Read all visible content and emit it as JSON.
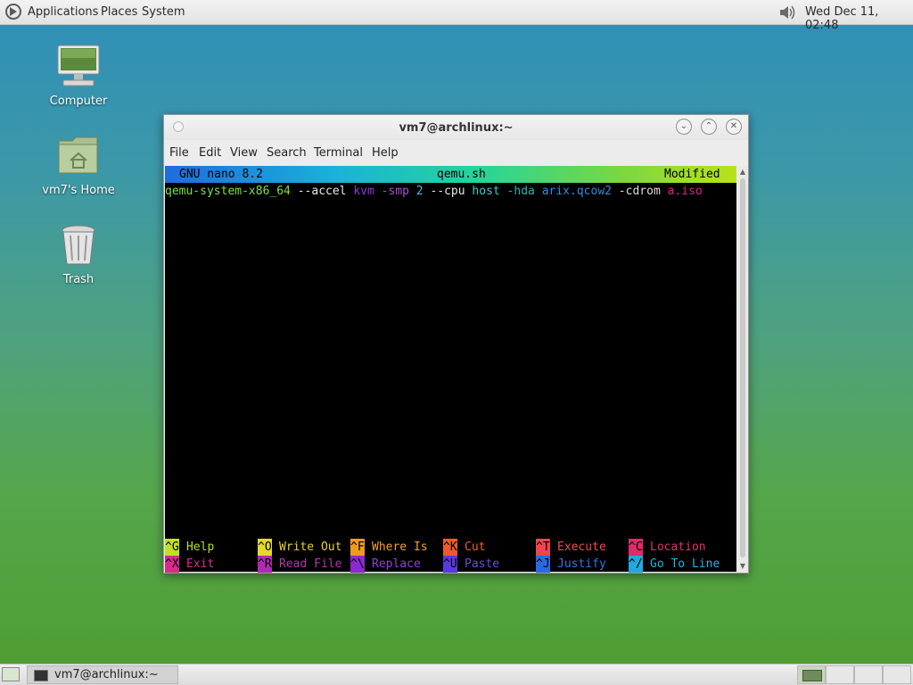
{
  "top_panel": {
    "menus": [
      "Applications",
      "Places",
      "System"
    ],
    "clock": "Wed Dec 11, 02:48"
  },
  "desktop_icons": [
    {
      "label": "Computer",
      "icon": "computer-icon"
    },
    {
      "label": "vm7's Home",
      "icon": "home-folder-icon"
    },
    {
      "label": "Trash",
      "icon": "trash-icon"
    }
  ],
  "window": {
    "title": "vm7@archlinux:~",
    "menubar": [
      "File",
      "Edit",
      "View",
      "Search",
      "Terminal",
      "Help"
    ],
    "nano": {
      "version": "GNU nano 8.2",
      "filename": "qemu.sh",
      "status": "Modified",
      "content_tokens": [
        {
          "text": "qemu-system-x86_64",
          "color": "#7be03a"
        },
        {
          "text": " --accel ",
          "color": "#e8e8e8"
        },
        {
          "text": "kvm",
          "color": "#8a3ad8"
        },
        {
          "text": " -smp ",
          "color": "#a64dd6"
        },
        {
          "text": "2",
          "color": "#3cc0d8"
        },
        {
          "text": " --cpu ",
          "color": "#e8e8e8"
        },
        {
          "text": "host",
          "color": "#3cc8d4"
        },
        {
          "text": " -hda ",
          "color": "#26b2a8"
        },
        {
          "text": "arix.qcow2",
          "color": "#2d8ce0"
        },
        {
          "text": " -cdrom ",
          "color": "#dddddd"
        },
        {
          "text": "a.iso",
          "color": "#e0208a"
        }
      ],
      "shortcuts": [
        {
          "key": "^G",
          "label": "Help",
          "key_bg": "#c2e020",
          "label_color": "#b6e026"
        },
        {
          "key": "^O",
          "label": "Write Out",
          "key_bg": "#e6d82a",
          "label_color": "#e6d22a"
        },
        {
          "key": "^F",
          "label": "Where Is",
          "key_bg": "#f09a20",
          "label_color": "#f0a02a"
        },
        {
          "key": "^K",
          "label": "Cut",
          "key_bg": "#f05a2a",
          "label_color": "#f0602a"
        },
        {
          "key": "^T",
          "label": "Execute",
          "key_bg": "#f04452",
          "label_color": "#f04a52"
        },
        {
          "key": "^C",
          "label": "Location",
          "key_bg": "#e02a6a",
          "label_color": "#e03070"
        },
        {
          "key": "^X",
          "label": "Exit",
          "key_bg": "#d82a8a",
          "label_color": "#d8308e"
        },
        {
          "key": "^R",
          "label": "Read File",
          "key_bg": "#b02ab0",
          "label_color": "#b634b4"
        },
        {
          "key": "^\\",
          "label": "Replace",
          "key_bg": "#8a2ad0",
          "label_color": "#9040d8"
        },
        {
          "key": "^U",
          "label": "Paste",
          "key_bg": "#5a3ae0",
          "label_color": "#6a4ae0"
        },
        {
          "key": "^J",
          "label": "Justify",
          "key_bg": "#2a6ae0",
          "label_color": "#3276e6"
        },
        {
          "key": "^/",
          "label": "Go To Line",
          "key_bg": "#22a8e0",
          "label_color": "#26b0e6"
        }
      ]
    }
  },
  "taskbar": {
    "task_label": "vm7@archlinux:~"
  }
}
